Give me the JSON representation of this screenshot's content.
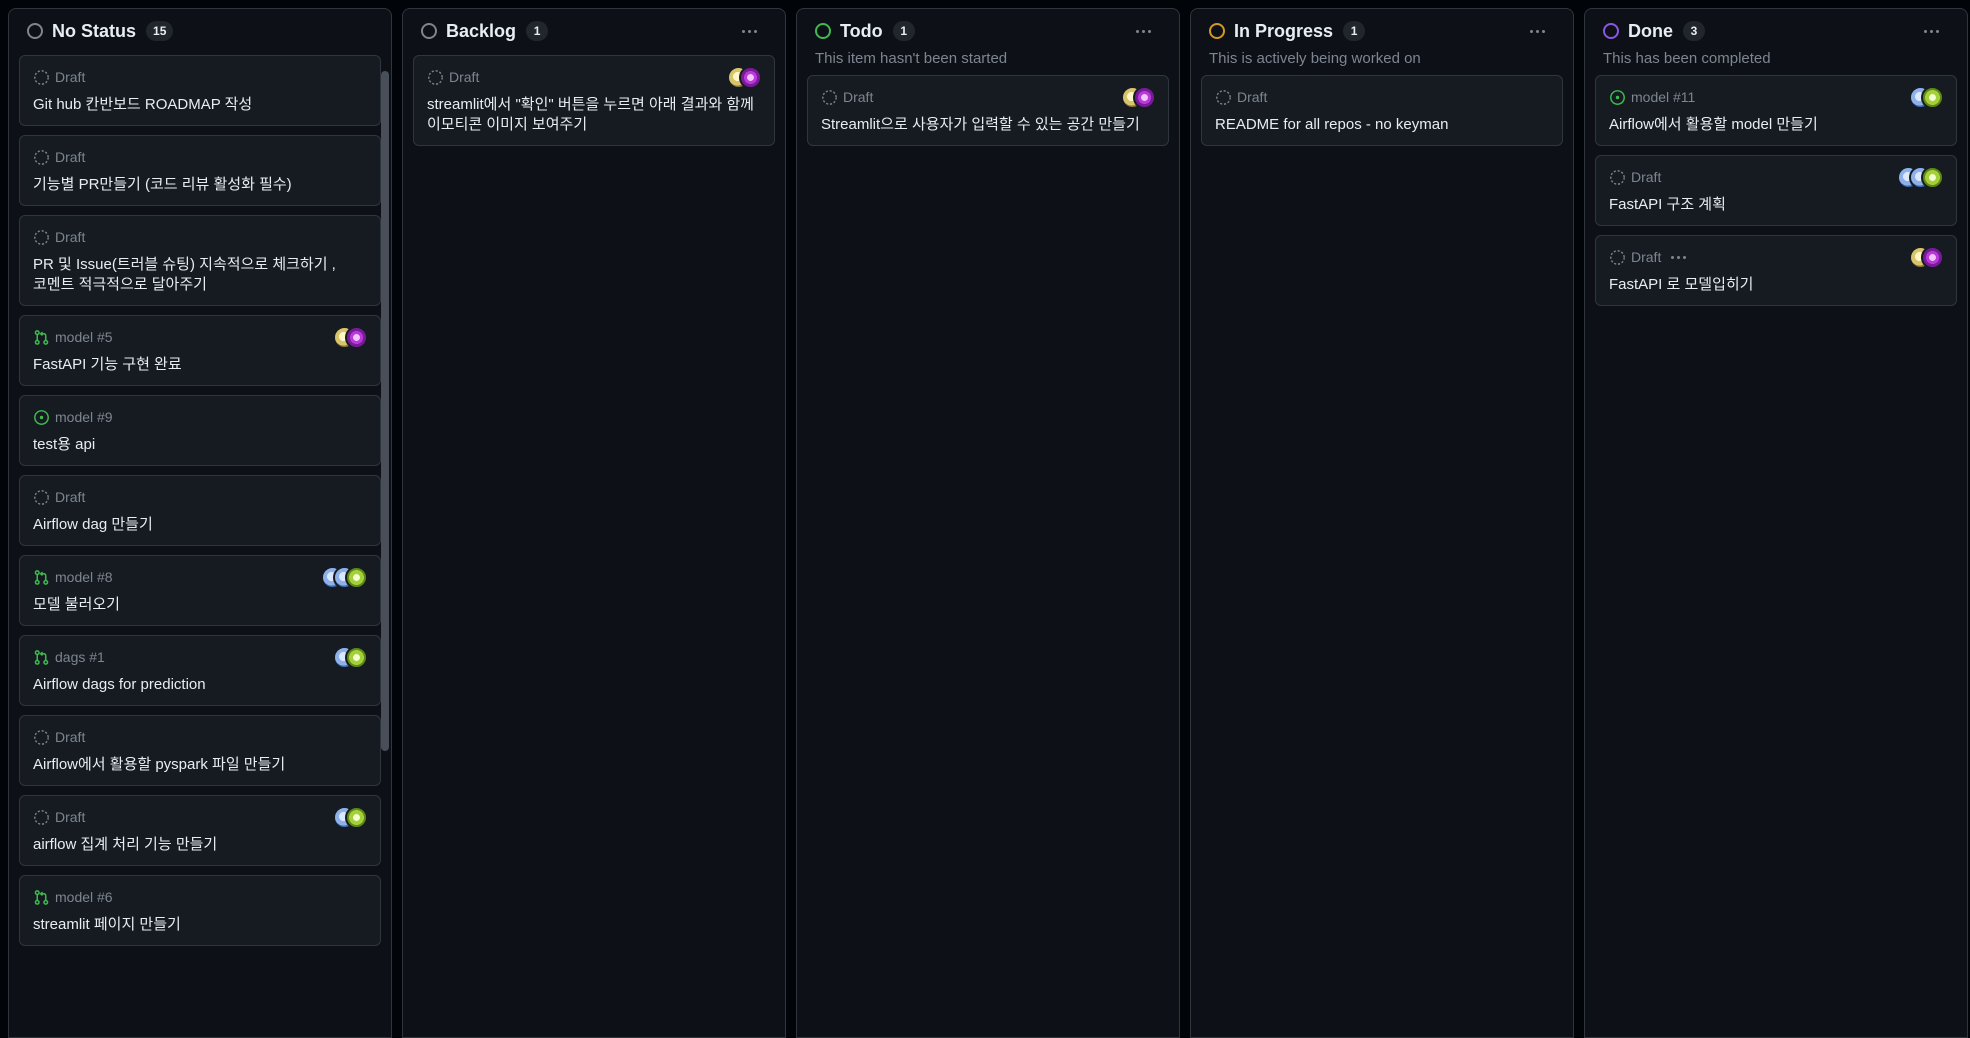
{
  "columns": [
    {
      "title": "No Status",
      "count": "15",
      "description": "",
      "ring_color": "#7d8590",
      "cards": [
        {
          "type": "draft",
          "meta": "Draft",
          "title": "Git hub 칸반보드 ROADMAP 작성",
          "avatars": []
        },
        {
          "type": "draft",
          "meta": "Draft",
          "title": "기능별 PR만들기 (코드 리뷰 활성화 필수)",
          "avatars": []
        },
        {
          "type": "draft",
          "meta": "Draft",
          "title": "PR 및 Issue(트러블 슈팅) 지속적으로 체크하기 , 코멘트 적극적으로 달아주기",
          "avatars": []
        },
        {
          "type": "pr",
          "meta": "model #5",
          "title": "FastAPI 기능 구현 완료",
          "avatars": [
            "yellow",
            "pink"
          ]
        },
        {
          "type": "issue",
          "meta": "model #9",
          "title": "test용 api",
          "avatars": []
        },
        {
          "type": "draft",
          "meta": "Draft",
          "title": "Airflow dag 만들기",
          "avatars": []
        },
        {
          "type": "pr",
          "meta": "model #8",
          "title": "모델 불러오기",
          "avatars": [
            "blue",
            "blue",
            "green"
          ]
        },
        {
          "type": "pr",
          "meta": "dags #1",
          "title": "Airflow dags for prediction",
          "avatars": [
            "blue",
            "green"
          ]
        },
        {
          "type": "draft",
          "meta": "Draft",
          "title": "Airflow에서 활용할 pyspark 파일 만들기",
          "avatars": []
        },
        {
          "type": "draft",
          "meta": "Draft",
          "title": "airflow 집계 처리 기능 만들기",
          "avatars": [
            "blue",
            "green"
          ]
        },
        {
          "type": "pr",
          "meta": "model #6",
          "title": "streamlit 페이지 만들기",
          "avatars": []
        }
      ]
    },
    {
      "title": "Backlog",
      "count": "1",
      "description": "",
      "ring_color": "#7d8590",
      "cards": [
        {
          "type": "draft",
          "meta": "Draft",
          "title": "streamlit에서 \"확인\" 버튼을 누르면 아래 결과와 함께 이모티콘 이미지 보여주기",
          "avatars": [
            "yellow",
            "pink"
          ]
        }
      ]
    },
    {
      "title": "Todo",
      "count": "1",
      "description": "This item hasn't been started",
      "ring_color": "#3fb950",
      "cards": [
        {
          "type": "draft",
          "meta": "Draft",
          "title": "Streamlit으로 사용자가 입력할 수 있는 공간 만들기",
          "avatars": [
            "yellow",
            "pink"
          ]
        }
      ]
    },
    {
      "title": "In Progress",
      "count": "1",
      "description": "This is actively being worked on",
      "ring_color": "#d29922",
      "cards": [
        {
          "type": "draft",
          "meta": "Draft",
          "title": "README for all repos - no keyman",
          "avatars": []
        }
      ]
    },
    {
      "title": "Done",
      "count": "3",
      "description": "This has been completed",
      "ring_color": "#8957e5",
      "cards": [
        {
          "type": "issue",
          "meta": "model #11",
          "title": "Airflow에서 활용할 model 만들기",
          "avatars": [
            "blue",
            "green"
          ]
        },
        {
          "type": "draft",
          "meta": "Draft",
          "title": "FastAPI 구조 계획",
          "avatars": [
            "blue",
            "blue",
            "green"
          ]
        },
        {
          "type": "draft",
          "meta": "Draft",
          "title": "FastAPI 로 모델입히기",
          "avatars": [
            "yellow",
            "pink"
          ],
          "menu": true
        }
      ]
    }
  ],
  "icons": {
    "draft": "draft-issue-icon",
    "pr": "pull-request-icon",
    "issue": "open-issue-icon"
  },
  "colors": {
    "background": "#010409",
    "column": "#0d1117",
    "card": "#161b22",
    "border": "#30363d",
    "pr_green": "#3fb950"
  }
}
